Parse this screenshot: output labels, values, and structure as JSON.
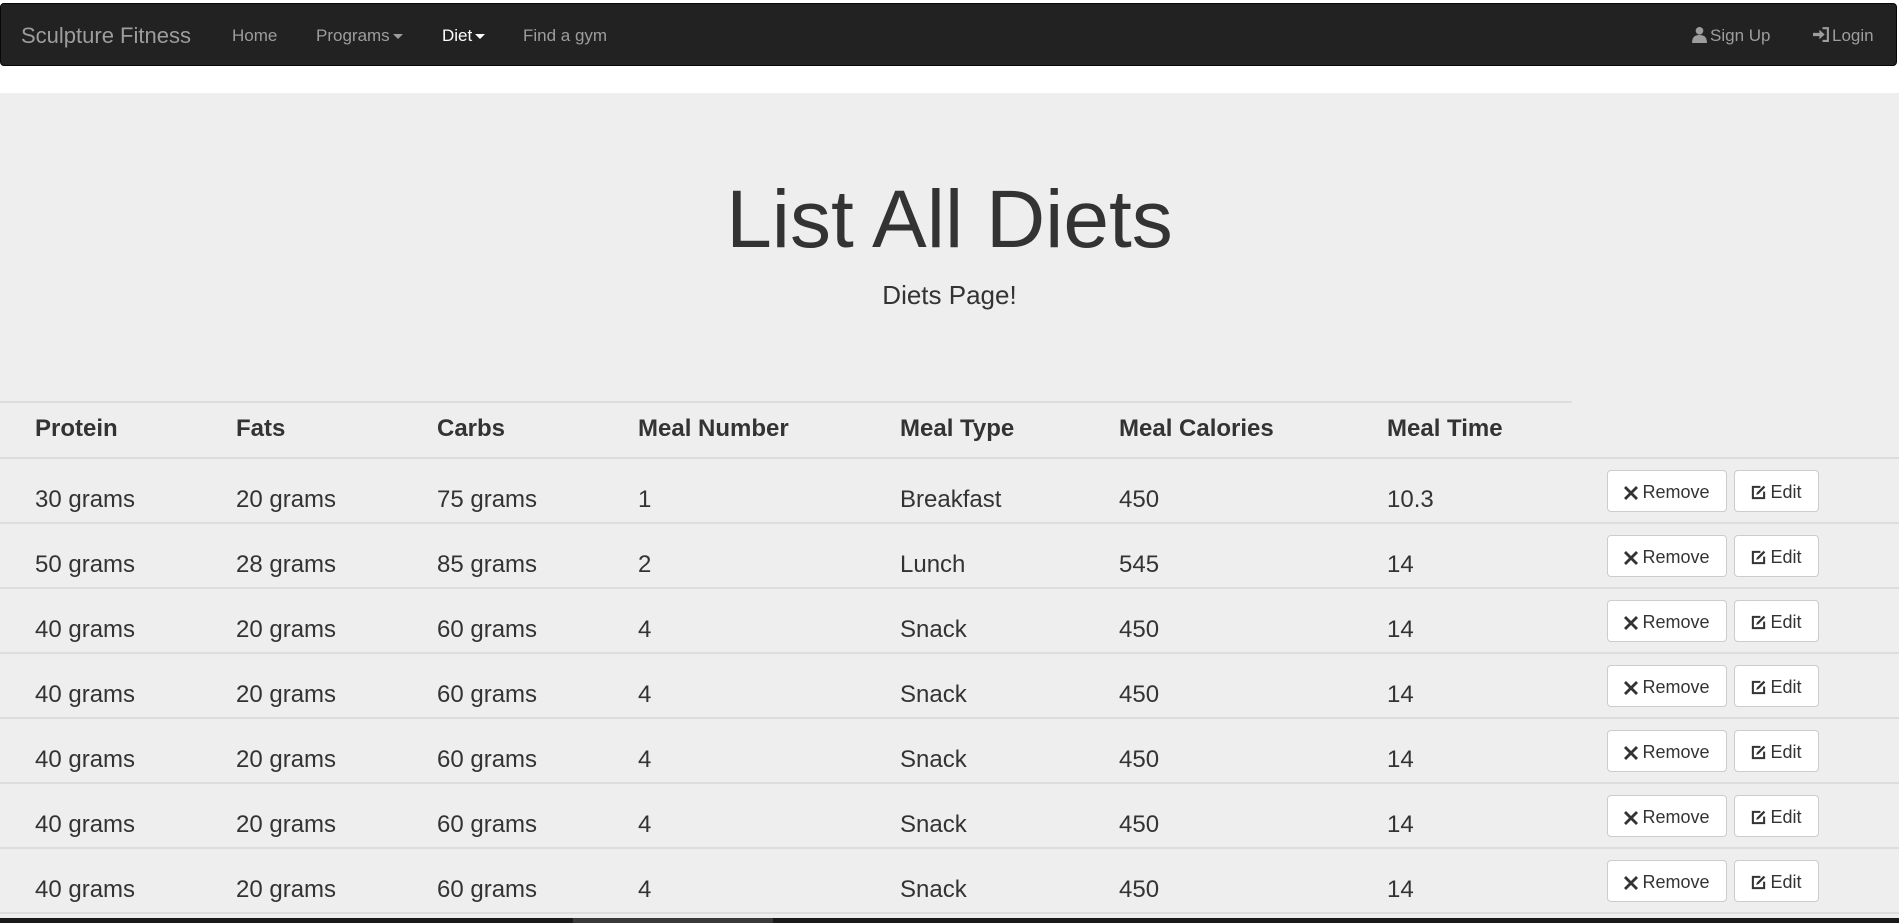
{
  "navbar": {
    "brand": "Sculpture Fitness",
    "items": [
      {
        "label": "Home"
      },
      {
        "label": "Programs"
      },
      {
        "label": "Diet"
      },
      {
        "label": "Find a gym"
      }
    ],
    "right_items": [
      {
        "label": "Sign Up",
        "icon": "user-icon"
      },
      {
        "label": "Login",
        "icon": "login-icon"
      }
    ],
    "active_item": "Diet"
  },
  "main": {
    "title": "List All Diets",
    "subtitle": "Diets Page!"
  },
  "table": {
    "columns": [
      "Protein",
      "Fats",
      "Carbs",
      "Meal Number",
      "Meal Type",
      "Meal Calories",
      "Meal Time"
    ],
    "rows": [
      [
        "30 grams",
        "20 grams",
        "75 grams",
        "1",
        "Breakfast",
        "450",
        "10.3"
      ],
      [
        "50 grams",
        "28 grams",
        "85 grams",
        "2",
        "Lunch",
        "545",
        "14"
      ],
      [
        "40 grams",
        "20 grams",
        "60 grams",
        "4",
        "Snack",
        "450",
        "14"
      ],
      [
        "40 grams",
        "20 grams",
        "60 grams",
        "4",
        "Snack",
        "450",
        "14"
      ],
      [
        "40 grams",
        "20 grams",
        "60 grams",
        "4",
        "Snack",
        "450",
        "14"
      ],
      [
        "40 grams",
        "20 grams",
        "60 grams",
        "4",
        "Snack",
        "450",
        "14"
      ],
      [
        "40 grams",
        "20 grams",
        "60 grams",
        "4",
        "Snack",
        "450",
        "14"
      ]
    ],
    "remove_label": "Remove",
    "edit_label": "Edit"
  },
  "colors": {
    "navbar_bg": "#222222",
    "nav_text": "#9d9d9d",
    "nav_active": "#ffffff",
    "jumbotron_bg": "#eeeeee",
    "text": "#333333",
    "border": "#dddddd"
  }
}
